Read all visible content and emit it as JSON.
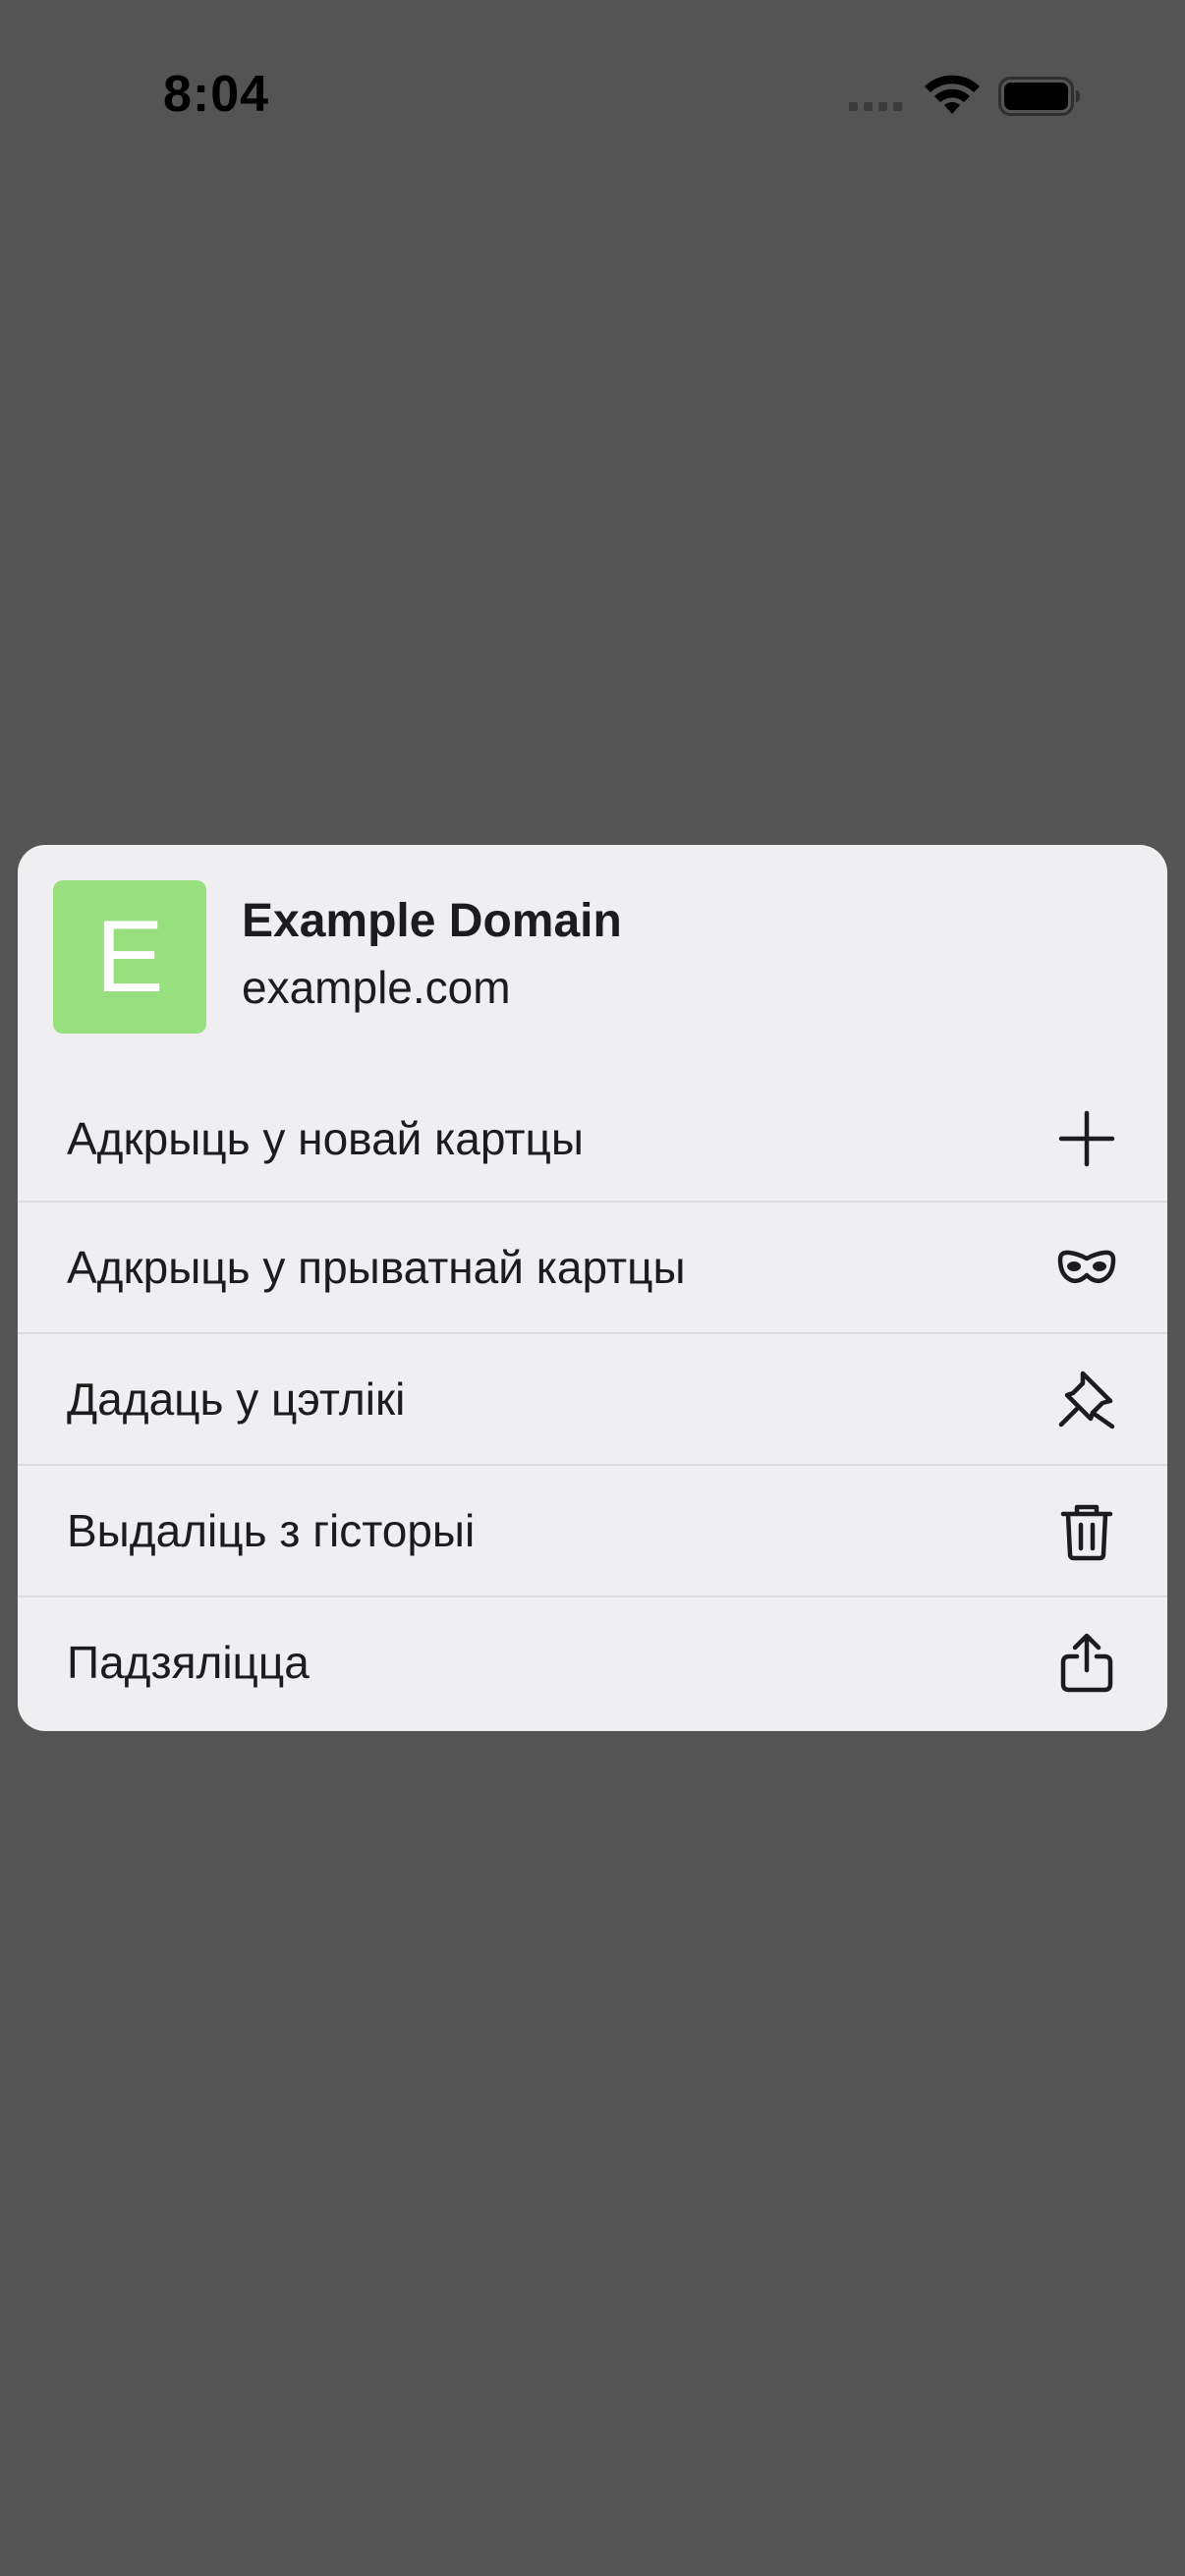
{
  "status_bar": {
    "time": "8:04"
  },
  "sheet": {
    "favicon_letter": "E",
    "favicon_color": "#98e07f",
    "site_title": "Example Domain",
    "site_url": "example.com",
    "menu_items": [
      {
        "label": "Адкрыць у новай картцы",
        "icon": "plus-icon"
      },
      {
        "label": "Адкрыць у прыватнай картцы",
        "icon": "private-mask-icon"
      },
      {
        "label": "Дадаць у цэтлікі",
        "icon": "pin-icon"
      },
      {
        "label": "Выдаліць з гісторыі",
        "icon": "trash-icon"
      },
      {
        "label": "Падзяліцца",
        "icon": "share-icon"
      }
    ]
  },
  "colors": {
    "backdrop": "#545454",
    "sheet": "#efeff1",
    "text": "#1c1c1e"
  }
}
